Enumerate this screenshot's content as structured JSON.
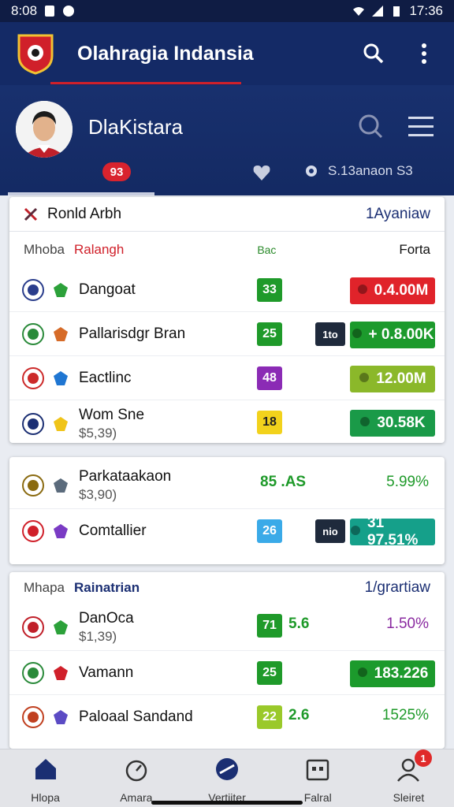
{
  "status_bar": {
    "time_left": "8:08",
    "time_right": "17:36"
  },
  "app_bar": {
    "title": "Olahragia Indansia",
    "search_icon": "search-icon",
    "menu_icon": "more-vert-icon"
  },
  "profile": {
    "name": "DlaKistara",
    "badge": "93",
    "stat": "S.13anaon S3"
  },
  "card1": {
    "title": "Ronld Arbh",
    "link": "1Ayaniaw",
    "cols": {
      "a": "Mhoba",
      "b": "Ralangh",
      "c": "Bac",
      "d": "Forta"
    },
    "rows": [
      {
        "name": "Dangoat",
        "score": "33",
        "score_color": "#1f9a2a",
        "odds": "0.4.00M",
        "odds_color": "#e0232a",
        "crest": "#2a3d8c",
        "mini": "#2ca13a"
      },
      {
        "name": "Pallarisdgr Bran",
        "score": "25",
        "score_color": "#1f9a2a",
        "tag": "1to",
        "odds": "+ 0.8.00K",
        "odds_color": "#1c9a2c",
        "crest": "#2a8a3a",
        "mini": "#d66b28"
      },
      {
        "name": "Eactlinc",
        "score": "48",
        "score_color": "#8b2bb5",
        "odds": "12.00M",
        "odds_color": "#8bb82a",
        "crest": "#cc2a2a",
        "mini": "#1f76d2"
      },
      {
        "name": "Wom Sne",
        "sub": "$5,39)",
        "score": "18",
        "score_color": "#f2d21c",
        "odds": "30.58K",
        "odds_color": "#1a9a48",
        "crest": "#1b2f73",
        "mini": "#f0c419"
      }
    ]
  },
  "card2": {
    "rows": [
      {
        "name": "Parkataakaon",
        "sub": "$3,90)",
        "mid": "85 .AS",
        "mid_color": "#1f9a2a",
        "value": "5.99%",
        "value_color": "#1f9a2a",
        "crest": "#8a6a10",
        "mini": "#5b6b7c"
      },
      {
        "name": "Comtallier",
        "score": "26",
        "score_color": "#3aaae8",
        "tag": "nio",
        "odds": "31 97.51%",
        "odds_color": "#15a08a",
        "crest": "#d0202a",
        "mini": "#7a3bc4"
      }
    ]
  },
  "card3": {
    "cols": {
      "a": "Mhapa",
      "b": "Rainatrian"
    },
    "link": "1/grartiaw",
    "rows": [
      {
        "name": "DanOca",
        "sub": "$1,39)",
        "score": "71",
        "score_color": "#1f9a2a",
        "mid": "5.6",
        "mid_color": "#1f9a2a",
        "value": "1.50%",
        "value_color": "#8a2aa0",
        "crest": "#c0202a",
        "mini": "#2ca13a"
      },
      {
        "name": "Vamann",
        "score": "25",
        "score_color": "#1f9a2a",
        "odds": "183.226",
        "odds_color": "#1c9a2c",
        "crest": "#2a8a3a",
        "mini": "#d0202a"
      },
      {
        "name": "Paloaal Sandand",
        "score": "22",
        "score_color": "#9ac92a",
        "mid": "2.6",
        "mid_color": "#1f9a2a",
        "value": "1525%",
        "value_color": "#1f9a2a",
        "crest": "#c04020",
        "mini": "#5b4bc4"
      }
    ]
  },
  "bottom_nav": [
    {
      "label": "Hlopa",
      "icon": "home-icon"
    },
    {
      "label": "Amara",
      "icon": "stopwatch-icon"
    },
    {
      "label": "Vertiiter",
      "icon": "compass-icon"
    },
    {
      "label": "Falral",
      "icon": "calendar-icon"
    },
    {
      "label": "Sleiret",
      "icon": "profile-icon",
      "badge": "1"
    }
  ]
}
